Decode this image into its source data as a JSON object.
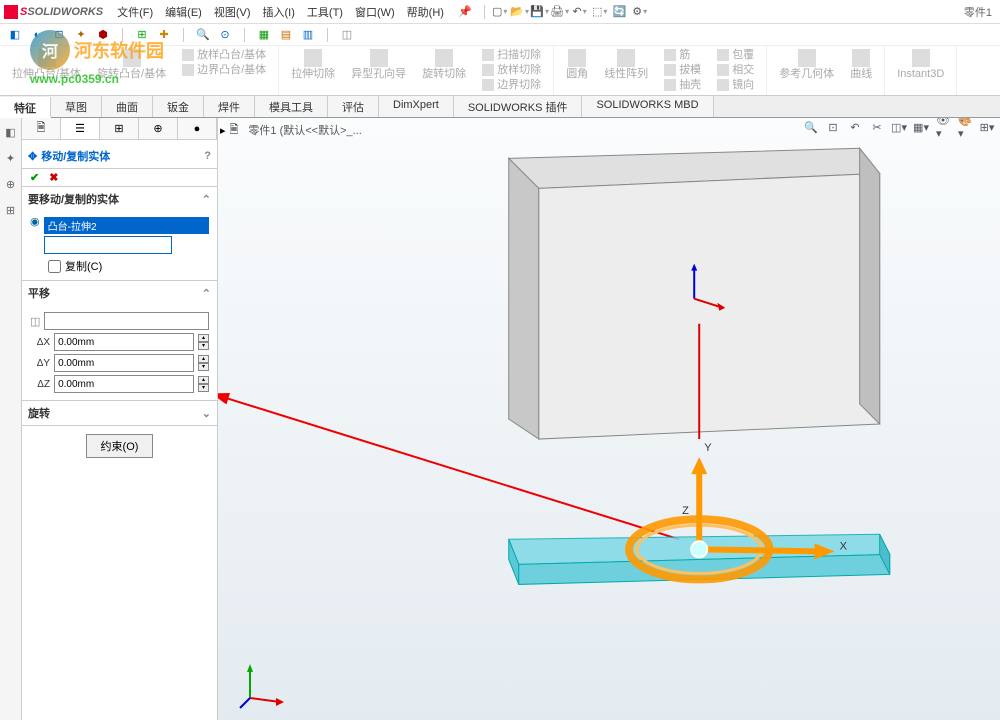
{
  "app": {
    "logo_text": "SOLIDWORKS",
    "doc": "零件1"
  },
  "menu": {
    "file": "文件(F)",
    "edit": "编辑(E)",
    "view": "视图(V)",
    "insert": "插入(I)",
    "tools": "工具(T)",
    "window": "窗口(W)",
    "help": "帮助(H)"
  },
  "watermark": {
    "title": "河东软件园",
    "url": "www.pc0359.cn"
  },
  "ribbon": {
    "g1": {
      "a": "拉伸凸台/基体",
      "b": "旋转凸台/基体",
      "c": "放样凸台/基体",
      "d": "边界凸台/基体"
    },
    "g2": {
      "a": "拉伸切除",
      "b": "异型孔向导",
      "c": "旋转切除",
      "d": "扫描切除",
      "e": "放样切除",
      "f": "边界切除"
    },
    "g3": {
      "a": "圆角",
      "b": "线性阵列",
      "c": "筋",
      "d": "拔模",
      "e": "抽壳",
      "f": "包覆",
      "g": "相交",
      "h": "镜向"
    },
    "g4": {
      "a": "参考几何体",
      "b": "曲线"
    },
    "g5": {
      "a": "Instant3D"
    }
  },
  "tabs": {
    "t1": "特征",
    "t2": "草图",
    "t3": "曲面",
    "t4": "钣金",
    "t5": "焊件",
    "t6": "模具工具",
    "t7": "评估",
    "t8": "DimXpert",
    "t9": "SOLIDWORKS 插件",
    "t10": "SOLIDWORKS MBD"
  },
  "crumb": "零件1  (默认<<默认>_...",
  "feature": {
    "title": "移动/复制实体",
    "sec1": {
      "h": "要移动/复制的实体",
      "item": "凸台-拉伸2",
      "copy": "复制(C)"
    },
    "sec2": {
      "h": "平移",
      "dx": "ΔX",
      "dy": "ΔY",
      "dz": "ΔZ",
      "vx": "0.00mm",
      "vy": "0.00mm",
      "vz": "0.00mm"
    },
    "sec3": {
      "h": "旋转"
    },
    "constraint": "约束(O)"
  },
  "axes": {
    "x": "X",
    "y": "Y",
    "z": "Z"
  }
}
